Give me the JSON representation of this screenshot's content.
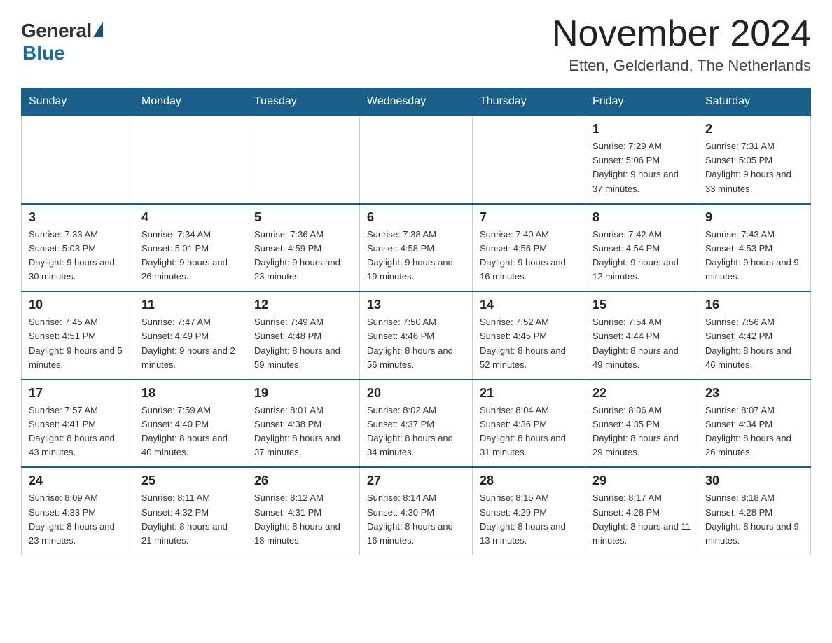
{
  "header": {
    "logo_general": "General",
    "logo_blue": "Blue",
    "month_title": "November 2024",
    "location": "Etten, Gelderland, The Netherlands"
  },
  "weekdays": [
    "Sunday",
    "Monday",
    "Tuesday",
    "Wednesday",
    "Thursday",
    "Friday",
    "Saturday"
  ],
  "weeks": [
    [
      {
        "day": "",
        "info": ""
      },
      {
        "day": "",
        "info": ""
      },
      {
        "day": "",
        "info": ""
      },
      {
        "day": "",
        "info": ""
      },
      {
        "day": "",
        "info": ""
      },
      {
        "day": "1",
        "info": "Sunrise: 7:29 AM\nSunset: 5:06 PM\nDaylight: 9 hours and 37 minutes."
      },
      {
        "day": "2",
        "info": "Sunrise: 7:31 AM\nSunset: 5:05 PM\nDaylight: 9 hours and 33 minutes."
      }
    ],
    [
      {
        "day": "3",
        "info": "Sunrise: 7:33 AM\nSunset: 5:03 PM\nDaylight: 9 hours and 30 minutes."
      },
      {
        "day": "4",
        "info": "Sunrise: 7:34 AM\nSunset: 5:01 PM\nDaylight: 9 hours and 26 minutes."
      },
      {
        "day": "5",
        "info": "Sunrise: 7:36 AM\nSunset: 4:59 PM\nDaylight: 9 hours and 23 minutes."
      },
      {
        "day": "6",
        "info": "Sunrise: 7:38 AM\nSunset: 4:58 PM\nDaylight: 9 hours and 19 minutes."
      },
      {
        "day": "7",
        "info": "Sunrise: 7:40 AM\nSunset: 4:56 PM\nDaylight: 9 hours and 16 minutes."
      },
      {
        "day": "8",
        "info": "Sunrise: 7:42 AM\nSunset: 4:54 PM\nDaylight: 9 hours and 12 minutes."
      },
      {
        "day": "9",
        "info": "Sunrise: 7:43 AM\nSunset: 4:53 PM\nDaylight: 9 hours and 9 minutes."
      }
    ],
    [
      {
        "day": "10",
        "info": "Sunrise: 7:45 AM\nSunset: 4:51 PM\nDaylight: 9 hours and 5 minutes."
      },
      {
        "day": "11",
        "info": "Sunrise: 7:47 AM\nSunset: 4:49 PM\nDaylight: 9 hours and 2 minutes."
      },
      {
        "day": "12",
        "info": "Sunrise: 7:49 AM\nSunset: 4:48 PM\nDaylight: 8 hours and 59 minutes."
      },
      {
        "day": "13",
        "info": "Sunrise: 7:50 AM\nSunset: 4:46 PM\nDaylight: 8 hours and 56 minutes."
      },
      {
        "day": "14",
        "info": "Sunrise: 7:52 AM\nSunset: 4:45 PM\nDaylight: 8 hours and 52 minutes."
      },
      {
        "day": "15",
        "info": "Sunrise: 7:54 AM\nSunset: 4:44 PM\nDaylight: 8 hours and 49 minutes."
      },
      {
        "day": "16",
        "info": "Sunrise: 7:56 AM\nSunset: 4:42 PM\nDaylight: 8 hours and 46 minutes."
      }
    ],
    [
      {
        "day": "17",
        "info": "Sunrise: 7:57 AM\nSunset: 4:41 PM\nDaylight: 8 hours and 43 minutes."
      },
      {
        "day": "18",
        "info": "Sunrise: 7:59 AM\nSunset: 4:40 PM\nDaylight: 8 hours and 40 minutes."
      },
      {
        "day": "19",
        "info": "Sunrise: 8:01 AM\nSunset: 4:38 PM\nDaylight: 8 hours and 37 minutes."
      },
      {
        "day": "20",
        "info": "Sunrise: 8:02 AM\nSunset: 4:37 PM\nDaylight: 8 hours and 34 minutes."
      },
      {
        "day": "21",
        "info": "Sunrise: 8:04 AM\nSunset: 4:36 PM\nDaylight: 8 hours and 31 minutes."
      },
      {
        "day": "22",
        "info": "Sunrise: 8:06 AM\nSunset: 4:35 PM\nDaylight: 8 hours and 29 minutes."
      },
      {
        "day": "23",
        "info": "Sunrise: 8:07 AM\nSunset: 4:34 PM\nDaylight: 8 hours and 26 minutes."
      }
    ],
    [
      {
        "day": "24",
        "info": "Sunrise: 8:09 AM\nSunset: 4:33 PM\nDaylight: 8 hours and 23 minutes."
      },
      {
        "day": "25",
        "info": "Sunrise: 8:11 AM\nSunset: 4:32 PM\nDaylight: 8 hours and 21 minutes."
      },
      {
        "day": "26",
        "info": "Sunrise: 8:12 AM\nSunset: 4:31 PM\nDaylight: 8 hours and 18 minutes."
      },
      {
        "day": "27",
        "info": "Sunrise: 8:14 AM\nSunset: 4:30 PM\nDaylight: 8 hours and 16 minutes."
      },
      {
        "day": "28",
        "info": "Sunrise: 8:15 AM\nSunset: 4:29 PM\nDaylight: 8 hours and 13 minutes."
      },
      {
        "day": "29",
        "info": "Sunrise: 8:17 AM\nSunset: 4:28 PM\nDaylight: 8 hours and 11 minutes."
      },
      {
        "day": "30",
        "info": "Sunrise: 8:18 AM\nSunset: 4:28 PM\nDaylight: 8 hours and 9 minutes."
      }
    ]
  ]
}
